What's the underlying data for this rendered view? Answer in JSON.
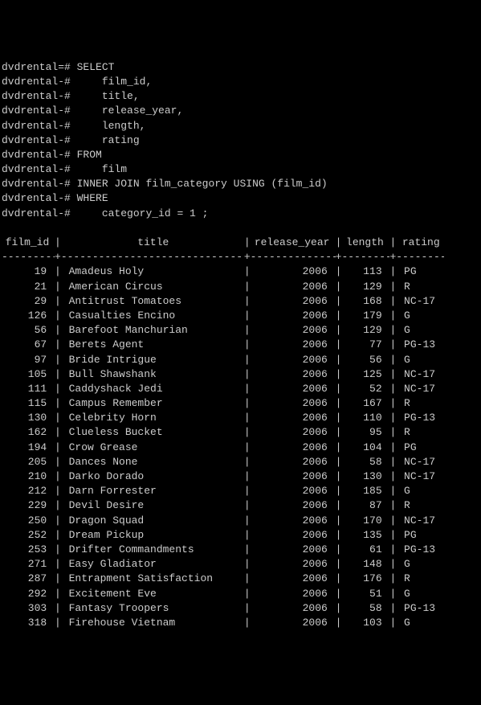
{
  "sql_lines": [
    {
      "prompt": "dvdrental=#",
      "text": " SELECT"
    },
    {
      "prompt": "dvdrental-#",
      "text": "     film_id,"
    },
    {
      "prompt": "dvdrental-#",
      "text": "     title,"
    },
    {
      "prompt": "dvdrental-#",
      "text": "     release_year,"
    },
    {
      "prompt": "dvdrental-#",
      "text": "     length,"
    },
    {
      "prompt": "dvdrental-#",
      "text": "     rating"
    },
    {
      "prompt": "dvdrental-#",
      "text": " FROM"
    },
    {
      "prompt": "dvdrental-#",
      "text": "     film"
    },
    {
      "prompt": "dvdrental-#",
      "text": " INNER JOIN film_category USING (film_id)"
    },
    {
      "prompt": "dvdrental-#",
      "text": " WHERE"
    },
    {
      "prompt": "dvdrental-#",
      "text": "     category_id = 1 ;"
    }
  ],
  "headers": {
    "film_id": "film_id",
    "title": "title",
    "release_year": "release_year",
    "length": "length",
    "rating": "rating"
  },
  "rows": [
    {
      "film_id": "19",
      "title": "Amadeus Holy",
      "release_year": "2006",
      "length": "113",
      "rating": "PG"
    },
    {
      "film_id": "21",
      "title": "American Circus",
      "release_year": "2006",
      "length": "129",
      "rating": "R"
    },
    {
      "film_id": "29",
      "title": "Antitrust Tomatoes",
      "release_year": "2006",
      "length": "168",
      "rating": "NC-17"
    },
    {
      "film_id": "126",
      "title": "Casualties Encino",
      "release_year": "2006",
      "length": "179",
      "rating": "G"
    },
    {
      "film_id": "56",
      "title": "Barefoot Manchurian",
      "release_year": "2006",
      "length": "129",
      "rating": "G"
    },
    {
      "film_id": "67",
      "title": "Berets Agent",
      "release_year": "2006",
      "length": "77",
      "rating": "PG-13"
    },
    {
      "film_id": "97",
      "title": "Bride Intrigue",
      "release_year": "2006",
      "length": "56",
      "rating": "G"
    },
    {
      "film_id": "105",
      "title": "Bull Shawshank",
      "release_year": "2006",
      "length": "125",
      "rating": "NC-17"
    },
    {
      "film_id": "111",
      "title": "Caddyshack Jedi",
      "release_year": "2006",
      "length": "52",
      "rating": "NC-17"
    },
    {
      "film_id": "115",
      "title": "Campus Remember",
      "release_year": "2006",
      "length": "167",
      "rating": "R"
    },
    {
      "film_id": "130",
      "title": "Celebrity Horn",
      "release_year": "2006",
      "length": "110",
      "rating": "PG-13"
    },
    {
      "film_id": "162",
      "title": "Clueless Bucket",
      "release_year": "2006",
      "length": "95",
      "rating": "R"
    },
    {
      "film_id": "194",
      "title": "Crow Grease",
      "release_year": "2006",
      "length": "104",
      "rating": "PG"
    },
    {
      "film_id": "205",
      "title": "Dances None",
      "release_year": "2006",
      "length": "58",
      "rating": "NC-17"
    },
    {
      "film_id": "210",
      "title": "Darko Dorado",
      "release_year": "2006",
      "length": "130",
      "rating": "NC-17"
    },
    {
      "film_id": "212",
      "title": "Darn Forrester",
      "release_year": "2006",
      "length": "185",
      "rating": "G"
    },
    {
      "film_id": "229",
      "title": "Devil Desire",
      "release_year": "2006",
      "length": "87",
      "rating": "R"
    },
    {
      "film_id": "250",
      "title": "Dragon Squad",
      "release_year": "2006",
      "length": "170",
      "rating": "NC-17"
    },
    {
      "film_id": "252",
      "title": "Dream Pickup",
      "release_year": "2006",
      "length": "135",
      "rating": "PG"
    },
    {
      "film_id": "253",
      "title": "Drifter Commandments",
      "release_year": "2006",
      "length": "61",
      "rating": "PG-13"
    },
    {
      "film_id": "271",
      "title": "Easy Gladiator",
      "release_year": "2006",
      "length": "148",
      "rating": "G"
    },
    {
      "film_id": "287",
      "title": "Entrapment Satisfaction",
      "release_year": "2006",
      "length": "176",
      "rating": "R"
    },
    {
      "film_id": "292",
      "title": "Excitement Eve",
      "release_year": "2006",
      "length": "51",
      "rating": "G"
    },
    {
      "film_id": "303",
      "title": "Fantasy Troopers",
      "release_year": "2006",
      "length": "58",
      "rating": "PG-13"
    },
    {
      "film_id": "318",
      "title": "Firehouse Vietnam",
      "release_year": "2006",
      "length": "103",
      "rating": "G"
    }
  ]
}
